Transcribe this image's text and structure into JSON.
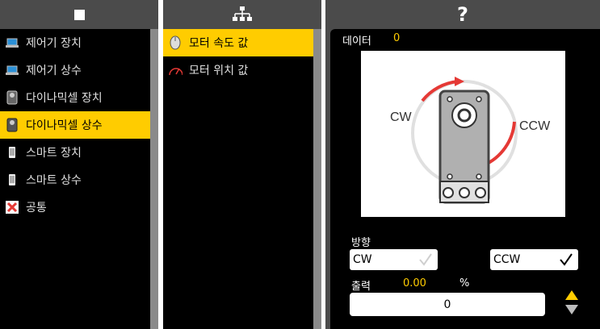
{
  "left_panel": {
    "header_icon": "square-icon",
    "items": [
      {
        "label": "제어기 장치",
        "icon": "laptop-icon"
      },
      {
        "label": "제어기 상수",
        "icon": "laptop-icon"
      },
      {
        "label": "다이나믹셀 장치",
        "icon": "servo-icon"
      },
      {
        "label": "다이나믹셀 상수",
        "icon": "servo-icon"
      },
      {
        "label": "스마트 장치",
        "icon": "phone-icon"
      },
      {
        "label": "스마트 상수",
        "icon": "phone-icon"
      },
      {
        "label": "공통",
        "icon": "x-tool-icon"
      }
    ],
    "selected_index": 3
  },
  "mid_panel": {
    "header_icon": "hierarchy-icon",
    "items": [
      {
        "label": "모터 속도 값",
        "icon": "motor-icon"
      },
      {
        "label": "모터 위치 값",
        "icon": "gauge-icon"
      }
    ],
    "selected_index": 0
  },
  "right_panel": {
    "header_icon": "question-icon",
    "header_text": "?",
    "data_label": "데이터",
    "data_value": "0",
    "illustration": {
      "cw_label": "CW",
      "ccw_label": "CCW"
    },
    "direction_label": "방향",
    "direction_options": [
      {
        "label": "CW",
        "checked": false
      },
      {
        "label": "CCW",
        "checked": true
      }
    ],
    "output_label": "출력",
    "output_value": "0.00",
    "output_unit": "%",
    "output_input_value": "0",
    "colors": {
      "accent": "#ffcc00",
      "panel": "#4b4b4b",
      "arrow": "#e53935"
    }
  }
}
